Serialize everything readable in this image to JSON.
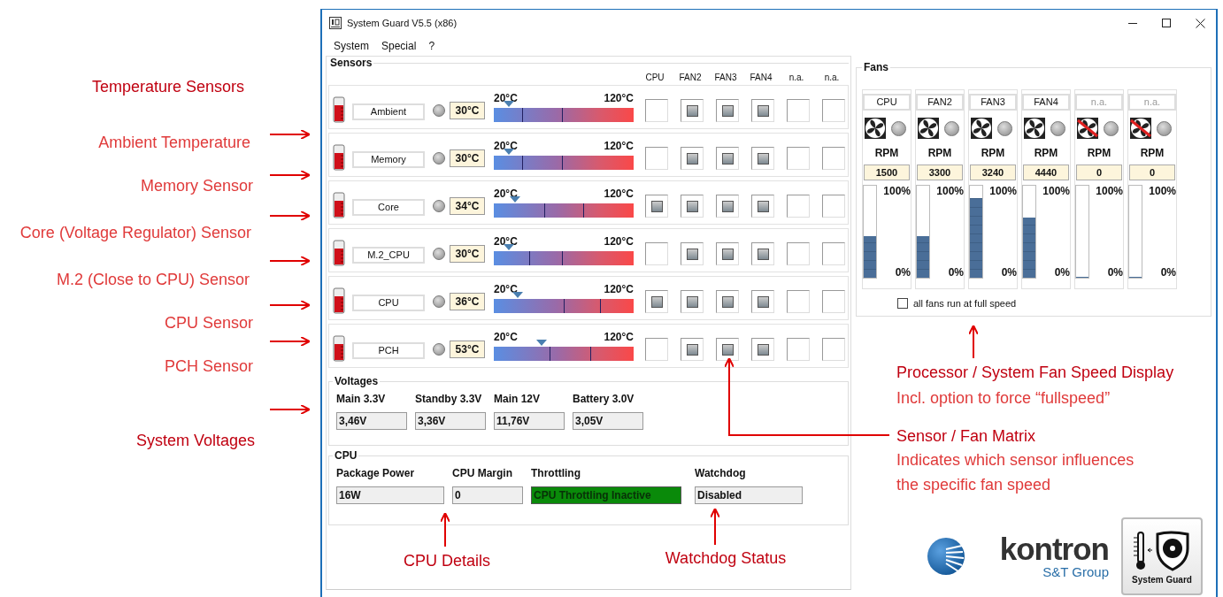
{
  "window": {
    "title": "System Guard V5.5 (x86)"
  },
  "menu": [
    {
      "label": "System"
    },
    {
      "label": "Special"
    },
    {
      "label": "?"
    }
  ],
  "sensors_group": {
    "title": "Sensors",
    "columns": [
      "CPU",
      "FAN2",
      "FAN3",
      "FAN4",
      "n.a.",
      "n.a."
    ]
  },
  "sensors": [
    {
      "name": "Ambient",
      "reading": "30°C",
      "min_label": "20°C",
      "max_label": "120°C",
      "level": 0.11,
      "thresholds": [
        {
          "level": 0.2
        },
        {
          "level": 0.49
        }
      ],
      "fans": [
        {
          "checked": false
        },
        {
          "checked": true
        },
        {
          "checked": true
        },
        {
          "checked": true
        },
        {
          "checked": false
        },
        {
          "checked": false
        }
      ]
    },
    {
      "name": "Memory",
      "reading": "30°C",
      "min_label": "20°C",
      "max_label": "120°C",
      "level": 0.11,
      "thresholds": [
        {
          "level": 0.2
        },
        {
          "level": 0.49
        }
      ],
      "fans": [
        {
          "checked": false
        },
        {
          "checked": true
        },
        {
          "checked": true
        },
        {
          "checked": true
        },
        {
          "checked": false
        },
        {
          "checked": false
        }
      ]
    },
    {
      "name": "Core",
      "reading": "34°C",
      "min_label": "20°C",
      "max_label": "120°C",
      "level": 0.15,
      "thresholds": [
        {
          "level": 0.36
        },
        {
          "level": 0.64
        }
      ],
      "fans": [
        {
          "checked": true
        },
        {
          "checked": true
        },
        {
          "checked": true
        },
        {
          "checked": true
        },
        {
          "checked": false
        },
        {
          "checked": false
        }
      ]
    },
    {
      "name": "M.2_CPU",
      "reading": "30°C",
      "min_label": "20°C",
      "max_label": "120°C",
      "level": 0.11,
      "thresholds": [
        {
          "level": 0.25
        },
        {
          "level": 0.49
        }
      ],
      "fans": [
        {
          "checked": false
        },
        {
          "checked": true
        },
        {
          "checked": true
        },
        {
          "checked": true
        },
        {
          "checked": false
        },
        {
          "checked": false
        }
      ]
    },
    {
      "name": "CPU",
      "reading": "36°C",
      "min_label": "20°C",
      "max_label": "120°C",
      "level": 0.17,
      "thresholds": [
        {
          "level": 0.5
        },
        {
          "level": 0.76
        }
      ],
      "fans": [
        {
          "checked": true
        },
        {
          "checked": true
        },
        {
          "checked": true
        },
        {
          "checked": true
        },
        {
          "checked": false
        },
        {
          "checked": false
        }
      ]
    },
    {
      "name": "PCH",
      "reading": "53°C",
      "min_label": "20°C",
      "max_label": "120°C",
      "level": 0.34,
      "thresholds": [
        {
          "level": 0.4
        },
        {
          "level": 0.69
        }
      ],
      "fans": [
        {
          "checked": false
        },
        {
          "checked": true
        },
        {
          "checked": true
        },
        {
          "checked": true
        },
        {
          "checked": false
        },
        {
          "checked": false
        }
      ]
    }
  ],
  "fans_group": {
    "title": "Fans"
  },
  "fans": [
    {
      "name": "CPU",
      "disabled": false,
      "unit": "RPM",
      "rpm": "1500",
      "level": 0.45,
      "max_label": "100%",
      "min_label": "0%"
    },
    {
      "name": "FAN2",
      "disabled": false,
      "unit": "RPM",
      "rpm": "3300",
      "level": 0.45,
      "max_label": "100%",
      "min_label": "0%"
    },
    {
      "name": "FAN3",
      "disabled": false,
      "unit": "RPM",
      "rpm": "3240",
      "level": 0.87,
      "max_label": "100%",
      "min_label": "0%"
    },
    {
      "name": "FAN4",
      "disabled": false,
      "unit": "RPM",
      "rpm": "4440",
      "level": 0.65,
      "max_label": "100%",
      "min_label": "0%"
    },
    {
      "name": "n.a.",
      "disabled": true,
      "unit": "RPM",
      "rpm": "0",
      "level": 0,
      "max_label": "100%",
      "min_label": "0%"
    },
    {
      "name": "n.a.",
      "disabled": true,
      "unit": "RPM",
      "rpm": "0",
      "level": 0,
      "max_label": "100%",
      "min_label": "0%"
    }
  ],
  "full_speed": {
    "label": "all fans run at full speed",
    "checked": false
  },
  "voltages": {
    "title": "Voltages",
    "items": [
      {
        "label": "Main 3.3V",
        "value": "3,46V"
      },
      {
        "label": "Standby 3.3V",
        "value": "3,36V"
      },
      {
        "label": "Main 12V",
        "value": "11,76V"
      },
      {
        "label": "Battery 3.0V",
        "value": "3,05V"
      }
    ]
  },
  "cpu": {
    "title": "CPU",
    "items": [
      {
        "label": "Package Power",
        "value": "16W",
        "highlighted": false
      },
      {
        "label": "CPU Margin",
        "value": "0",
        "highlighted": false
      },
      {
        "label": "Throttling",
        "value": "CPU Throttling Inactive",
        "highlighted": true
      },
      {
        "label": "Watchdog",
        "value": "Disabled",
        "highlighted": false
      }
    ]
  },
  "branding": {
    "company": "kontron",
    "group": "S&T Group",
    "product": "System Guard"
  },
  "annotations": [
    {
      "kind": "heading",
      "text": "Temperature Sensors"
    },
    {
      "kind": "note",
      "text": "Ambient Temperature"
    },
    {
      "kind": "note",
      "text": "Memory Sensor"
    },
    {
      "kind": "note",
      "text": "Core (Voltage Regulator) Sensor"
    },
    {
      "kind": "note",
      "text": "M.2 (Close to CPU) Sensor"
    },
    {
      "kind": "note",
      "text": "CPU Sensor"
    },
    {
      "kind": "note",
      "text": "PCH Sensor"
    },
    {
      "kind": "heading",
      "text": "System Voltages"
    },
    {
      "kind": "heading",
      "text": "Processor / System Fan Speed Display"
    },
    {
      "kind": "note",
      "text": "Incl. option to force “fullspeed”"
    },
    {
      "kind": "heading",
      "text": "Sensor / Fan Matrix"
    },
    {
      "kind": "note",
      "text": "Indicates which sensor influences"
    },
    {
      "kind": "note",
      "text": "the specific fan speed"
    },
    {
      "kind": "heading",
      "text": "CPU Details"
    },
    {
      "kind": "heading",
      "text": "Watchdog Status"
    }
  ]
}
